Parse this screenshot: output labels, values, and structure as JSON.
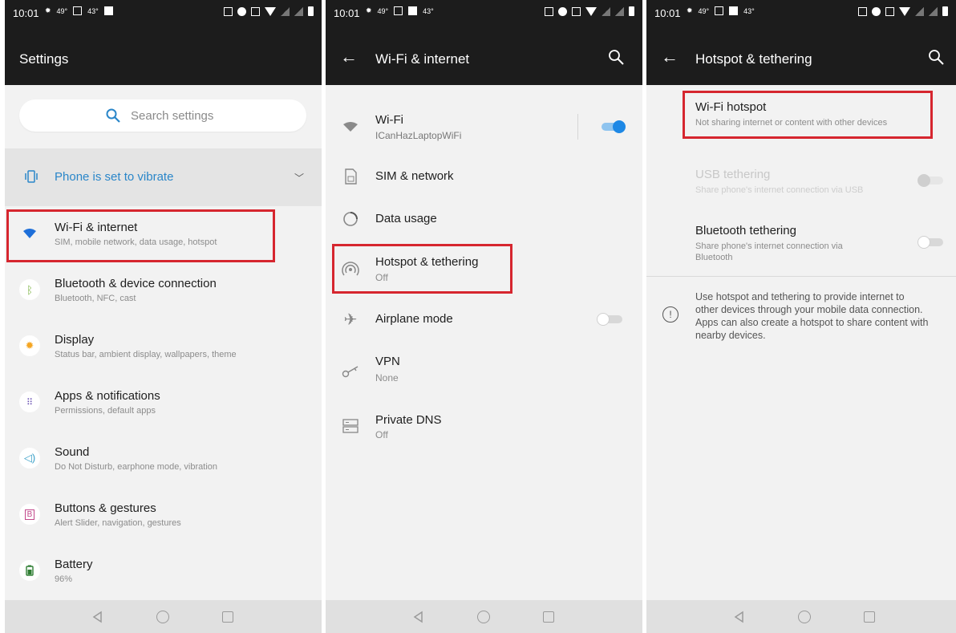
{
  "status_bar": {
    "time": "10:01",
    "temp1": "49°",
    "temp2": "43°"
  },
  "panel1": {
    "title": "Settings",
    "search": {
      "placeholder": "Search settings"
    },
    "vibrate_banner": "Phone is set to vibrate",
    "items": [
      {
        "title": "Wi-Fi & internet",
        "subtitle": "SIM, mobile network, data usage, hotspot",
        "icon": "wifi-icon"
      },
      {
        "title": "Bluetooth & device connection",
        "subtitle": "Bluetooth, NFC, cast",
        "icon": "bluetooth-icon"
      },
      {
        "title": "Display",
        "subtitle": "Status bar, ambient display, wallpapers, theme",
        "icon": "brightness-icon"
      },
      {
        "title": "Apps & notifications",
        "subtitle": "Permissions, default apps",
        "icon": "apps-grid-icon"
      },
      {
        "title": "Sound",
        "subtitle": "Do Not Disturb, earphone mode, vibration",
        "icon": "speaker-icon"
      },
      {
        "title": "Buttons & gestures",
        "subtitle": "Alert Slider, navigation, gestures",
        "icon": "buttons-icon"
      },
      {
        "title": "Battery",
        "subtitle": "96%",
        "icon": "battery-icon"
      }
    ]
  },
  "panel2": {
    "title": "Wi-Fi & internet",
    "items": [
      {
        "title": "Wi-Fi",
        "subtitle": "ICanHazLaptopWiFi",
        "icon": "wifi-icon",
        "toggle": "on"
      },
      {
        "title": "SIM & network",
        "subtitle": "",
        "icon": "sim-card-icon"
      },
      {
        "title": "Data usage",
        "subtitle": "",
        "icon": "data-usage-icon"
      },
      {
        "title": "Hotspot & tethering",
        "subtitle": "Off",
        "icon": "hotspot-icon"
      },
      {
        "title": "Airplane mode",
        "subtitle": "",
        "icon": "airplane-icon",
        "toggle": "off"
      },
      {
        "title": "VPN",
        "subtitle": "None",
        "icon": "vpn-key-icon"
      },
      {
        "title": "Private DNS",
        "subtitle": "Off",
        "icon": "dns-icon"
      }
    ]
  },
  "panel3": {
    "title": "Hotspot & tethering",
    "items": [
      {
        "title": "Wi-Fi hotspot",
        "subtitle": "Not sharing internet or content with other devices"
      },
      {
        "title": "USB tethering",
        "subtitle": "Share phone's internet connection via USB",
        "toggle": "disabled"
      },
      {
        "title": "Bluetooth tethering",
        "subtitle_line1": "Share phone's internet connection via",
        "subtitle_line2": "Bluetooth",
        "toggle": "off"
      }
    ],
    "info": {
      "line1": "Use hotspot and tethering to provide internet to",
      "line2": "other devices through your mobile data connection.",
      "line3": "Apps can also create a hotspot to share content with",
      "line4": "nearby devices."
    }
  },
  "colors": {
    "highlight": "#d6262f",
    "accent": "#1e88e5",
    "appbar": "#1c1c1c"
  }
}
